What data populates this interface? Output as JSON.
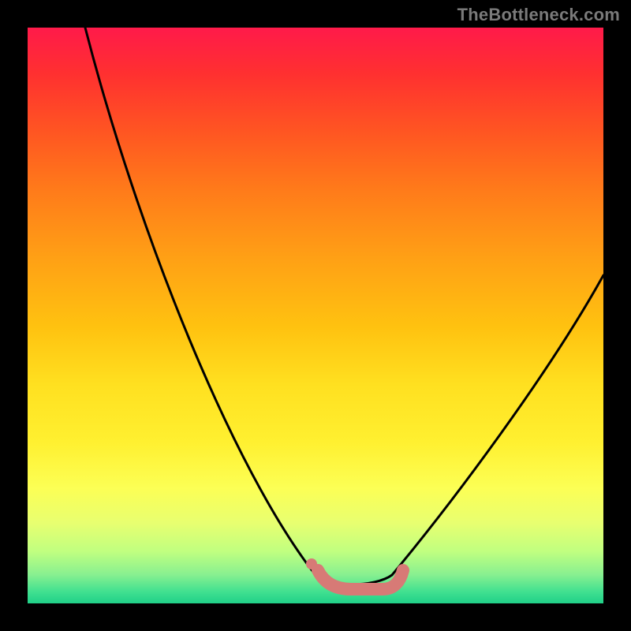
{
  "watermark": "TheBottleneck.com",
  "chart_data": {
    "type": "line",
    "title": "",
    "xlabel": "",
    "ylabel": "",
    "xlim": [
      0,
      100
    ],
    "ylim": [
      0,
      100
    ],
    "grid": false,
    "legend": false,
    "series": [
      {
        "name": "bottleneck-curve",
        "x": [
          10,
          15,
          20,
          25,
          30,
          35,
          40,
          45,
          50,
          52,
          55,
          58,
          60,
          63,
          65,
          70,
          75,
          80,
          85,
          90,
          95,
          100
        ],
        "values": [
          100,
          88,
          76,
          65,
          54,
          44,
          34,
          24,
          14,
          8,
          4,
          2,
          2,
          3,
          5,
          10,
          17,
          25,
          33,
          41,
          49,
          57
        ]
      }
    ],
    "annotations": [
      {
        "name": "plateau-blob",
        "x_start": 52,
        "x_end": 64,
        "y": 2,
        "color": "#d77a76"
      }
    ],
    "background_gradient": {
      "top": "#ff1a4a",
      "mid": "#ffe020",
      "bottom": "#20d088"
    }
  }
}
